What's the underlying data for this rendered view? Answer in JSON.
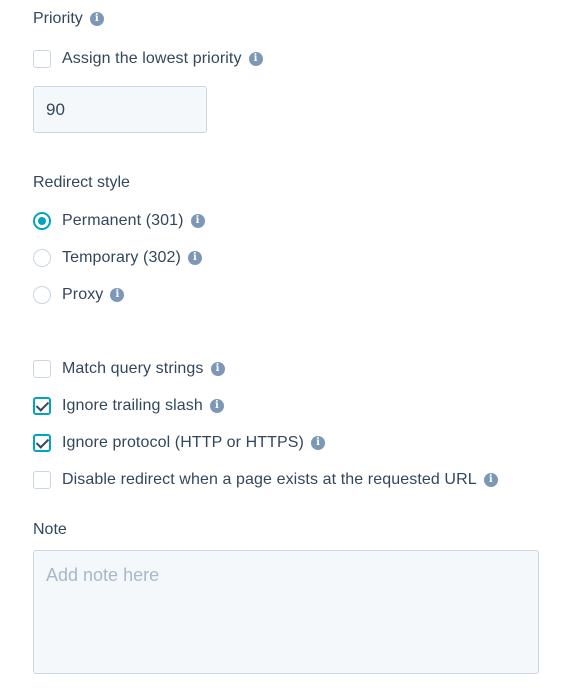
{
  "priority": {
    "label": "Priority",
    "lowest_priority_label": "Assign the lowest priority",
    "lowest_priority_checked": false,
    "value": "90"
  },
  "redirect_style": {
    "label": "Redirect style",
    "options": [
      {
        "label": "Permanent (301)",
        "selected": true
      },
      {
        "label": "Temporary (302)",
        "selected": false
      },
      {
        "label": "Proxy",
        "selected": false
      }
    ]
  },
  "options": [
    {
      "label": "Match query strings",
      "checked": false
    },
    {
      "label": "Ignore trailing slash",
      "checked": true
    },
    {
      "label": "Ignore protocol (HTTP or HTTPS)",
      "checked": true
    },
    {
      "label": "Disable redirect when a page exists at the requested URL",
      "checked": false
    }
  ],
  "note": {
    "label": "Note",
    "placeholder": "Add note here",
    "value": ""
  },
  "info_glyph": "i",
  "colors": {
    "text": "#33475b",
    "accent": "#00a4bd",
    "border": "#cbd6e2",
    "input_bg": "#f5f8fa",
    "info_icon": "#7c98b6",
    "placeholder": "#a8b8c9"
  }
}
